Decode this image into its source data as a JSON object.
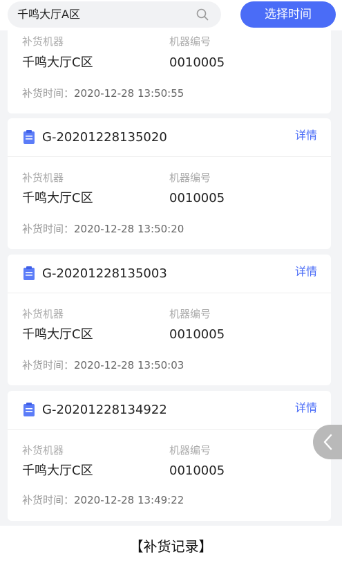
{
  "search": {
    "value": "千鸣大厅A区",
    "icon": "search-icon"
  },
  "time_button": {
    "label": "选择时间"
  },
  "labels": {
    "machine": "补货机器",
    "machine_no": "机器编号",
    "time_prefix": "补货时间：",
    "detail": "详情"
  },
  "partial_card": {
    "machine_label": "补货机器",
    "machine_no_label": "机器编号",
    "machine": "千鸣大厅C区",
    "machine_no": "0010005",
    "time": "2020-12-28 13:50:55"
  },
  "records": [
    {
      "order_no": "G-20201228135020",
      "machine": "千鸣大厅C区",
      "machine_no": "0010005",
      "time": "2020-12-28 13:50:20"
    },
    {
      "order_no": "G-20201228135003",
      "machine": "千鸣大厅C区",
      "machine_no": "0010005",
      "time": "2020-12-28 13:50:03"
    },
    {
      "order_no": "G-20201228134922",
      "machine": "千鸣大厅C区",
      "machine_no": "0010005",
      "time": "2020-12-28 13:49:22"
    }
  ],
  "caption": "【补货记录】",
  "colors": {
    "accent": "#4a6cf7",
    "background": "#f3f4f6",
    "doc_icon": "#5b7cf8"
  }
}
